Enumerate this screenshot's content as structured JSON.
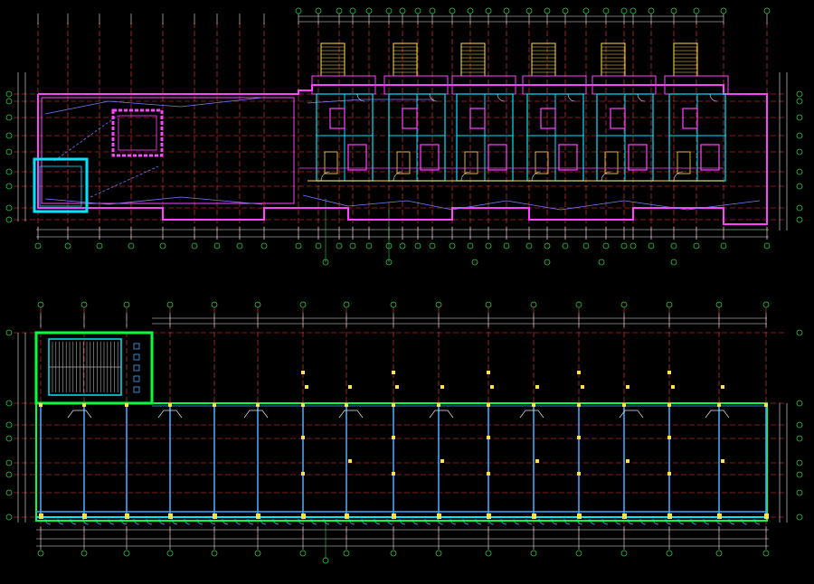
{
  "drawing": {
    "background": "#000000",
    "colors": {
      "axis": "#ff3b3b",
      "grid_bubble": "#2ecc40",
      "dimension": "#e8e8e8",
      "wall": "#ff44ff",
      "wall_alt": "#00e5ff",
      "stair": "#ffe14d",
      "column": "#ffe14d",
      "slab_edge": "#00ff3c",
      "partition": "#3fa9ff",
      "hatch": "#b0b0b0"
    },
    "upper_plan": {
      "title": "",
      "scale": ""
    },
    "lower_plan": {
      "title": "",
      "scale": ""
    }
  }
}
